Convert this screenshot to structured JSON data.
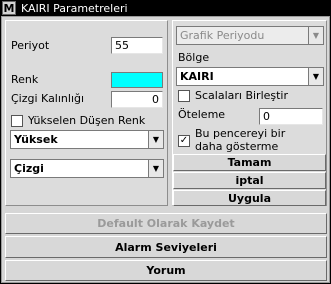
{
  "window": {
    "icon": "M",
    "title": "KAIRI Parametreleri"
  },
  "left": {
    "period_label": "Periyot",
    "period_value": "55",
    "color_label": "Renk",
    "color_value": "#00ffff",
    "thickness_label": "Çizgi Kalınlığı",
    "thickness_value": "0",
    "updown_label": "Yükselen Düşen Renk",
    "updown_checked": false,
    "level_select": "Yüksek",
    "style_select": "Çizgi"
  },
  "right": {
    "period_select": "Grafik Periyodu",
    "region_label": "Bölge",
    "region_select": "KAIRI",
    "merge_label": "Scalaları Birleştir",
    "merge_checked": false,
    "offset_label": "Öteleme",
    "offset_value": "0",
    "keep_label": "Bu pencereyi bir daha gösterme",
    "keep_checked": true,
    "ok_button": "Tamam",
    "cancel_button": "iptal",
    "apply_button": "Uygula"
  },
  "bottom": {
    "default_button": "Default Olarak Kaydet",
    "alarm_button": "Alarm Seviyeleri",
    "comment_button": "Yorum"
  },
  "icons": {
    "check": "✓",
    "dropdown": "▼"
  }
}
